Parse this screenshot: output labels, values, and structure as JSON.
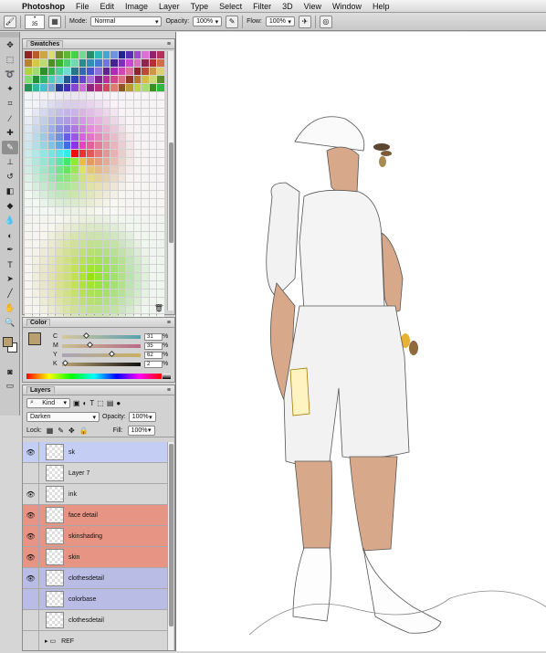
{
  "menu": {
    "apple": "",
    "items": [
      "Photoshop",
      "File",
      "Edit",
      "Image",
      "Layer",
      "Type",
      "Select",
      "Filter",
      "3D",
      "View",
      "Window",
      "Help"
    ]
  },
  "options": {
    "brush_size": "35",
    "mode_label": "Mode:",
    "mode_value": "Normal",
    "opacity_label": "Opacity:",
    "opacity_value": "100%",
    "flow_label": "Flow:",
    "flow_value": "100%"
  },
  "swatches": {
    "tab": "Swatches"
  },
  "color": {
    "tab": "Color",
    "channels": [
      {
        "label": "C",
        "value": "31",
        "unit": "%"
      },
      {
        "label": "M",
        "value": "35",
        "unit": "%"
      },
      {
        "label": "Y",
        "value": "62",
        "unit": "%"
      },
      {
        "label": "K",
        "value": "2",
        "unit": "%"
      }
    ],
    "fg_color": "#b8a071"
  },
  "layers": {
    "tab": "Layers",
    "filter": "Kind",
    "blend": "Darken",
    "opacity_label": "Opacity:",
    "opacity_value": "100%",
    "lock_label": "Lock:",
    "fill_label": "Fill:",
    "fill_value": "100%",
    "rows": [
      {
        "name": "sk",
        "color": "#c4cdf4",
        "eye": "👁"
      },
      {
        "name": "Layer 7",
        "color": "#d6d6d6",
        "eye": ""
      },
      {
        "name": "ink",
        "color": "#d6d6d6",
        "eye": "👁"
      },
      {
        "name": "face detail",
        "color": "#e79484",
        "eye": "👁"
      },
      {
        "name": "skinshading",
        "color": "#e79484",
        "eye": "👁"
      },
      {
        "name": "skin",
        "color": "#e79484",
        "eye": "👁"
      },
      {
        "name": "clothesdetail",
        "color": "#b9bde6",
        "eye": "👁"
      },
      {
        "name": "colorbase",
        "color": "#b9bde6",
        "eye": ""
      },
      {
        "name": "clothesdetail",
        "color": "#d6d6d6",
        "eye": ""
      },
      {
        "name": "REF",
        "color": "#d6d6d6",
        "eye": ""
      }
    ]
  }
}
